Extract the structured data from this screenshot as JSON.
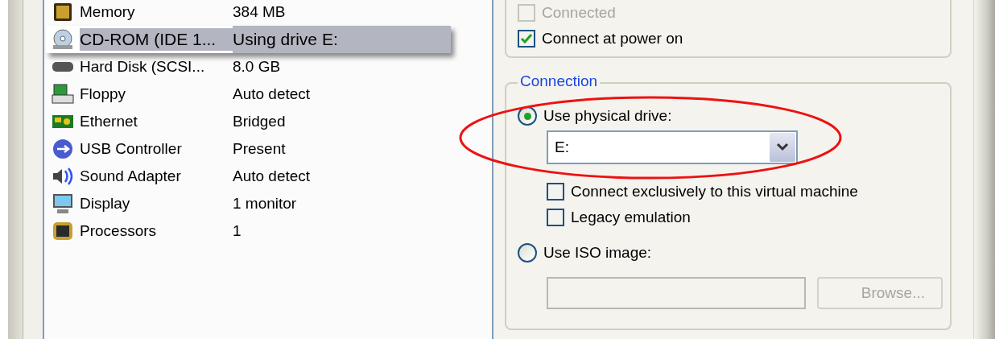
{
  "devices": [
    {
      "kind": "memory",
      "name": "Memory",
      "value": "384 MB",
      "selected": false
    },
    {
      "kind": "cdrom",
      "name": "CD-ROM (IDE 1...",
      "value": "Using drive E:",
      "selected": true
    },
    {
      "kind": "harddisk",
      "name": "Hard Disk (SCSI...",
      "value": "8.0 GB",
      "selected": false
    },
    {
      "kind": "floppy",
      "name": "Floppy",
      "value": "Auto detect",
      "selected": false
    },
    {
      "kind": "ethernet",
      "name": "Ethernet",
      "value": "Bridged",
      "selected": false
    },
    {
      "kind": "usb",
      "name": "USB Controller",
      "value": "Present",
      "selected": false
    },
    {
      "kind": "sound",
      "name": "Sound Adapter",
      "value": "Auto detect",
      "selected": false
    },
    {
      "kind": "display",
      "name": "Display",
      "value": "1 monitor",
      "selected": false
    },
    {
      "kind": "processor",
      "name": "Processors",
      "value": "1",
      "selected": false
    }
  ],
  "device_status": {
    "options": [
      {
        "label": "Connected",
        "checked": false,
        "disabled": true
      },
      {
        "label": "Connect at power on",
        "checked": true,
        "disabled": false
      }
    ]
  },
  "connection": {
    "legend": "Connection",
    "physical": {
      "label": "Use physical drive:",
      "selected": true,
      "drive": "E:",
      "options": [
        {
          "label": "Connect exclusively to this virtual machine",
          "checked": false,
          "disabled": false
        },
        {
          "label": "Legacy emulation",
          "checked": false,
          "disabled": false
        }
      ]
    },
    "iso": {
      "label": "Use ISO image:",
      "selected": false,
      "disabled": true,
      "browse": "Browse..."
    }
  }
}
